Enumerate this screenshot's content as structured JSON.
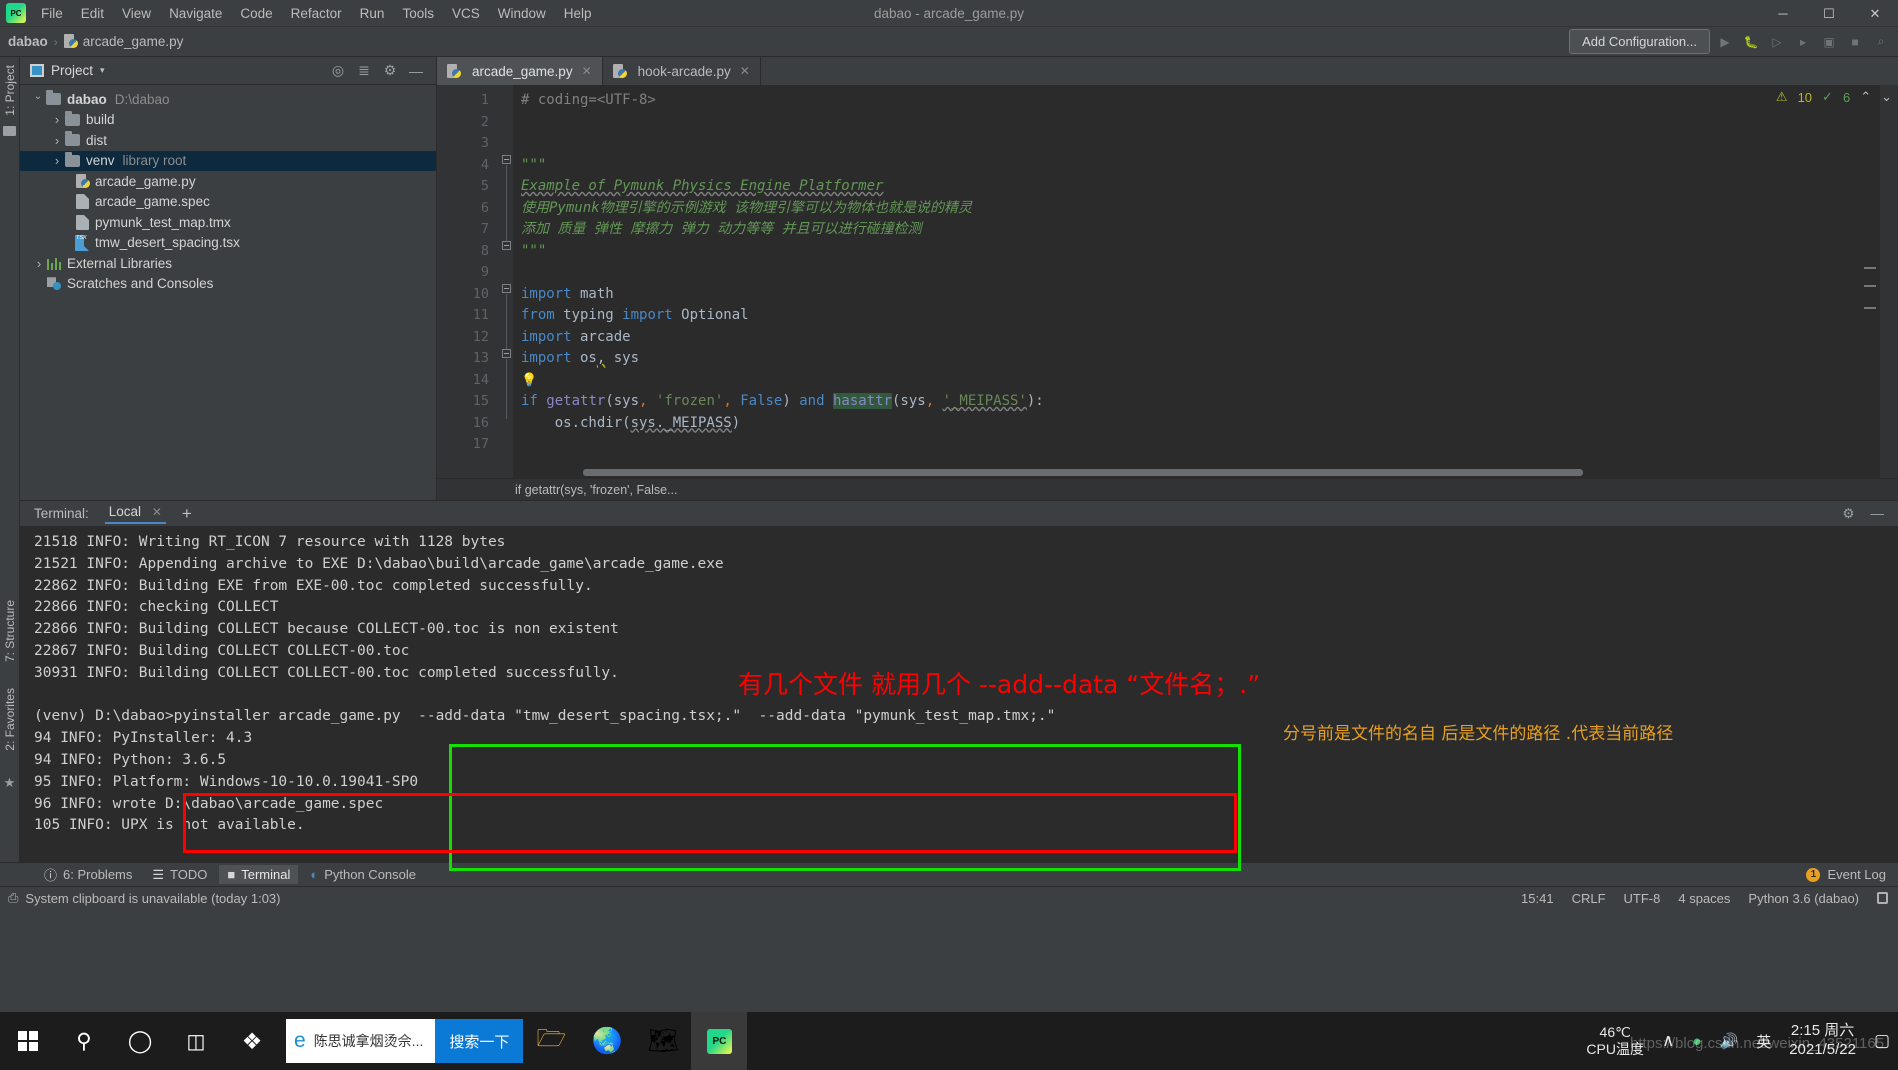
{
  "titlebar": {
    "app_icon": "pycharm-logo",
    "menus": [
      "File",
      "Edit",
      "View",
      "Navigate",
      "Code",
      "Refactor",
      "Run",
      "Tools",
      "VCS",
      "Window",
      "Help"
    ],
    "window_title": "dabao - arcade_game.py",
    "minimize": "─",
    "maximize": "☐",
    "close": "✕"
  },
  "navbar": {
    "project_crumb": "dabao",
    "separator": "›",
    "file_crumb": "arcade_game.py",
    "add_configuration": "Add Configuration...",
    "run_icon": "run-icon",
    "debug_icon": "debug-icon",
    "coverage_icon": "coverage-icon",
    "profile_icon": "profile-icon",
    "attach_icon": "attach-icon",
    "stop_icon": "stop-icon",
    "search_icon": "search-icon"
  },
  "project_panel": {
    "strip_label": "1: Project",
    "title": "Project",
    "caret": "▾",
    "actions": [
      "locate-icon",
      "collapse-all-icon",
      "settings-gear-icon",
      "hide-icon"
    ],
    "tree": [
      {
        "indent": 0,
        "arrow": "open",
        "icon": "folder",
        "name": "dabao",
        "bold": true,
        "hint": "D:\\dabao",
        "selected": false
      },
      {
        "indent": 1,
        "arrow": "closed",
        "icon": "folder",
        "name": "build",
        "bold": false,
        "hint": "",
        "selected": false
      },
      {
        "indent": 1,
        "arrow": "closed",
        "icon": "folder",
        "name": "dist",
        "bold": false,
        "hint": "",
        "selected": false
      },
      {
        "indent": 1,
        "arrow": "closed",
        "icon": "folder",
        "name": "venv",
        "bold": false,
        "hint": "library root",
        "selected": true
      },
      {
        "indent": 2,
        "arrow": "none",
        "icon": "python",
        "name": "arcade_game.py",
        "bold": false,
        "hint": "",
        "selected": false
      },
      {
        "indent": 2,
        "arrow": "none",
        "icon": "doc",
        "name": "arcade_game.spec",
        "bold": false,
        "hint": "",
        "selected": false
      },
      {
        "indent": 2,
        "arrow": "none",
        "icon": "doc",
        "name": "pymunk_test_map.tmx",
        "bold": false,
        "hint": "",
        "selected": false
      },
      {
        "indent": 2,
        "arrow": "none",
        "icon": "tsx",
        "name": "tmw_desert_spacing.tsx",
        "bold": false,
        "hint": "",
        "selected": false
      },
      {
        "indent": 0,
        "arrow": "closed",
        "icon": "lib",
        "name": "External Libraries",
        "bold": false,
        "hint": "",
        "selected": false
      },
      {
        "indent": 0,
        "arrow": "none",
        "icon": "scratch",
        "name": "Scratches and Consoles",
        "bold": false,
        "hint": "",
        "selected": false
      }
    ]
  },
  "editor": {
    "tabs": [
      {
        "label": "arcade_game.py",
        "active": true,
        "close": "✕"
      },
      {
        "label": "hook-arcade.py",
        "active": false,
        "close": "✕"
      }
    ],
    "line_numbers": [
      "1",
      "2",
      "3",
      "4",
      "5",
      "6",
      "7",
      "8",
      "9",
      "10",
      "11",
      "12",
      "13",
      "14",
      "15",
      "16",
      "17"
    ],
    "inspection": {
      "warning_icon": "warning-triangle-icon",
      "warning_count": "10",
      "ok_icon": "check-icon",
      "ok_count": "6",
      "up": "⌃",
      "down": "⌄"
    },
    "breadcrumb": "if getattr(sys, 'frozen', False...",
    "code_lines": [
      "# coding=<UTF-8>",
      "",
      "",
      "\"\"\"",
      "Example of Pymunk Physics Engine Platformer",
      "使用Pymunk物理引擎的示例游戏 该物理引擎可以为物体也就是说的精灵",
      "添加 质量 弹性 摩擦力 弹力 动力等等 并且可以进行碰撞检测",
      "\"\"\"",
      "",
      "import math",
      "from typing import Optional",
      "import arcade",
      "import os, sys",
      "",
      "if getattr(sys, 'frozen', False) and hasattr(sys, '_MEIPASS'):",
      "    os.chdir(sys._MEIPASS)",
      ""
    ]
  },
  "terminal": {
    "strip_label_structure": "7: Structure",
    "strip_label_favorites": "2: Favorites",
    "label": "Terminal:",
    "tab": "Local",
    "tab_close": "✕",
    "new_tab": "+",
    "settings_icon": "gear-icon",
    "hide_icon": "hide-icon",
    "lines": [
      "21518 INFO: Writing RT_ICON 7 resource with 1128 bytes",
      "21521 INFO: Appending archive to EXE D:\\dabao\\build\\arcade_game\\arcade_game.exe",
      "22862 INFO: Building EXE from EXE-00.toc completed successfully.",
      "22866 INFO: checking COLLECT",
      "22866 INFO: Building COLLECT because COLLECT-00.toc is non existent",
      "22867 INFO: Building COLLECT COLLECT-00.toc",
      "30931 INFO: Building COLLECT COLLECT-00.toc completed successfully.",
      "",
      "(venv) D:\\dabao>pyinstaller arcade_game.py  --add-data \"tmw_desert_spacing.tsx;.\"  --add-data \"pymunk_test_map.tmx;.\"",
      "94 INFO: PyInstaller: 4.3",
      "94 INFO: Python: 3.6.5",
      "95 INFO: Platform: Windows-10-10.0.19041-SP0",
      "96 INFO: wrote D:\\dabao\\arcade_game.spec",
      "105 INFO: UPX is not available."
    ]
  },
  "annotations": {
    "red_note": "有几个文件 就用几个 --add--data “文件名；.”",
    "orange_note": "分号前是文件的名自 后是文件的路径 .代表当前路径",
    "green_box_color": "#13e000",
    "red_box_color": "#ff0000"
  },
  "toolwindow_bar": {
    "items": [
      {
        "label": "6: Problems",
        "icon": "problems-icon",
        "active": false
      },
      {
        "label": "TODO",
        "icon": "todo-icon",
        "active": false
      },
      {
        "label": "Terminal",
        "icon": "terminal-icon",
        "active": true
      },
      {
        "label": "Python Console",
        "icon": "python-console-icon",
        "active": false
      }
    ],
    "event_log": "Event Log",
    "event_log_count": "1"
  },
  "statusbar": {
    "message": "System clipboard is unavailable (today 1:03)",
    "message_icon": "clipboard-icon",
    "time": "15:41",
    "line_separator": "CRLF",
    "encoding": "UTF-8",
    "indent": "4 spaces",
    "interpreter": "Python 3.6 (dabao)",
    "lock_icon": "lock-icon"
  },
  "taskbar": {
    "start_icon": "windows-start-icon",
    "search_icon": "search-icon",
    "cortana_icon": "cortana-icon",
    "taskview_icon": "task-view-icon",
    "app_icons": [
      "sogou-icon",
      "file-explorer-icon",
      "firefox-icon",
      "chrome-icon",
      "pycharm-icon"
    ],
    "search_box_text": "陈思诚拿烟烫佘...",
    "search_go": "搜索一下",
    "ie_icon": "internet-explorer-icon",
    "cpu_temp": "46℃",
    "cpu_temp_label": "CPU温度",
    "chevron_up": "∧",
    "ime": "英",
    "clock_time": "2:15 周六",
    "clock_date": "2021/5/22",
    "notification_icon": "notification-icon",
    "watermark": "https://blog.csdn.net/weixin_43521165"
  }
}
